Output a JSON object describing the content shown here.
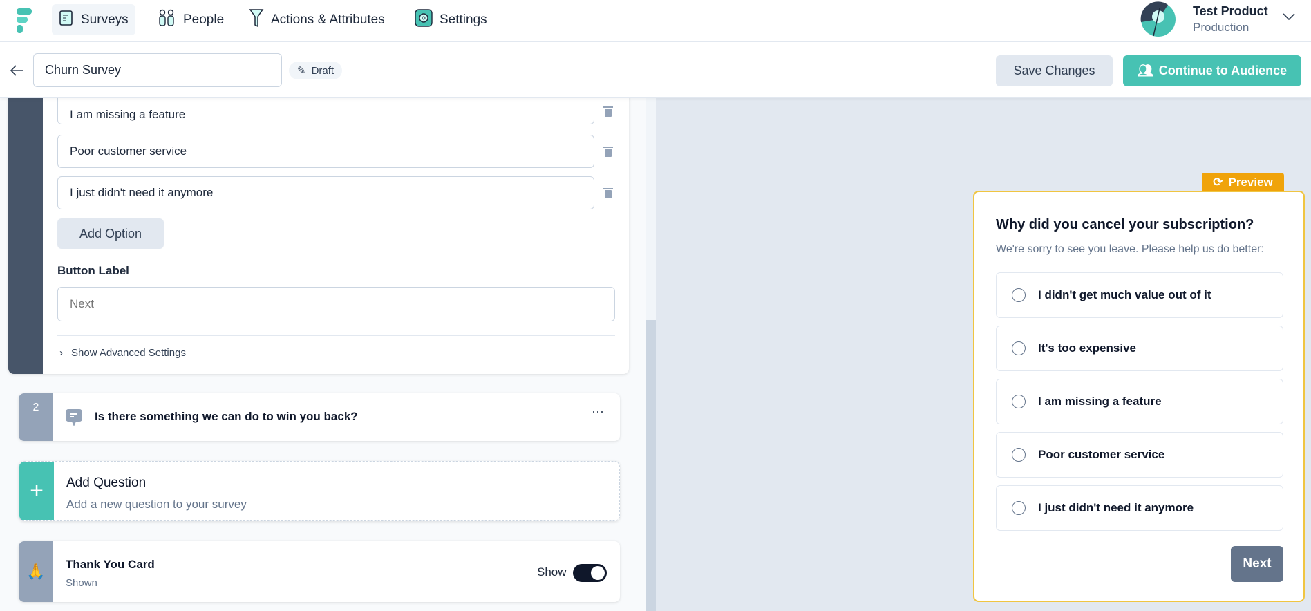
{
  "nav": {
    "items": [
      {
        "label": "Surveys",
        "icon": "survey-icon",
        "active": true
      },
      {
        "label": "People",
        "icon": "people-icon"
      },
      {
        "label": "Actions & Attributes",
        "icon": "funnel-icon"
      },
      {
        "label": "Settings",
        "icon": "gear-icon"
      }
    ],
    "product": {
      "name": "Test Product",
      "environment": "Production"
    }
  },
  "toolbar": {
    "survey_name": "Churn Survey",
    "status": "Draft",
    "save_label": "Save Changes",
    "continue_label": "Continue to Audience"
  },
  "editor": {
    "options": [
      "I am missing a feature",
      "Poor customer service",
      "I just didn't need it anymore"
    ],
    "add_option": "Add Option",
    "button_label_title": "Button Label",
    "button_label_placeholder": "Next",
    "advanced": "Show Advanced Settings",
    "q2": {
      "number": "2",
      "title": "Is there something we can do to win you back?"
    },
    "add_question": {
      "title": "Add Question",
      "subtitle": "Add a new question to your survey"
    },
    "thank_you": {
      "title": "Thank You Card",
      "status": "Shown",
      "toggle_label": "Show",
      "toggle_on": true
    }
  },
  "preview": {
    "badge": "Preview",
    "title": "Why did you cancel your subscription?",
    "subtitle": "We're sorry to see you leave. Please help us do better:",
    "options": [
      "I didn't get much value out of it",
      "It's too expensive",
      "I am missing a feature",
      "Poor customer service",
      "I just didn't need it anymore"
    ],
    "next": "Next"
  },
  "colors": {
    "brand": "#47c2b3",
    "preview": "#f0a30a",
    "dark": "#475569"
  }
}
